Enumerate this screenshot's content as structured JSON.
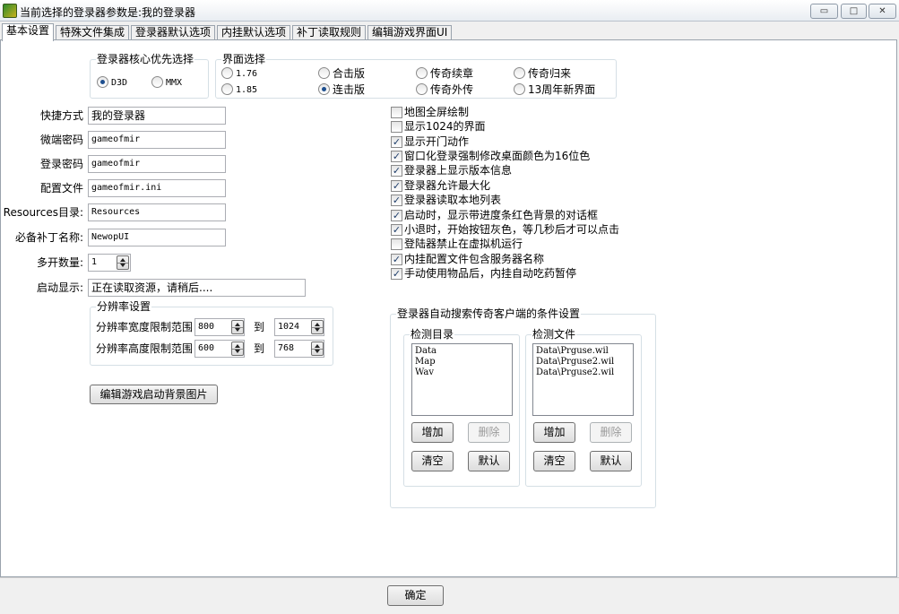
{
  "window": {
    "title": "当前选择的登录器参数是:我的登录器",
    "minimize_glyph": "▭",
    "restore_glyph": "□",
    "close_glyph": "✕"
  },
  "tabs": [
    "基本设置",
    "特殊文件集成",
    "登录器默认选项",
    "内挂默认选项",
    "补丁读取规则",
    "编辑游戏界面UI"
  ],
  "core": {
    "label": "登录器核心优先选择",
    "options": [
      {
        "label": "D3D",
        "selected": true
      },
      {
        "label": "MMX",
        "selected": false
      }
    ]
  },
  "ui_select": {
    "label": "界面选择",
    "options": [
      {
        "label": "1.76",
        "selected": false
      },
      {
        "label": "合击版",
        "selected": false
      },
      {
        "label": "传奇续章",
        "selected": false
      },
      {
        "label": "传奇归来",
        "selected": false
      },
      {
        "label": "1.85",
        "selected": false
      },
      {
        "label": "连击版",
        "selected": true
      },
      {
        "label": "传奇外传",
        "selected": false
      },
      {
        "label": "13周年新界面",
        "selected": false
      }
    ]
  },
  "form": {
    "shortcut": {
      "label": "快捷方式",
      "value": "我的登录器"
    },
    "micro_password": {
      "label": "微端密码",
      "value": "gameofmir"
    },
    "login_password": {
      "label": "登录密码",
      "value": "gameofmir"
    },
    "config_file": {
      "label": "配置文件",
      "value": "gameofmir.ini"
    },
    "resources_dir": {
      "label": "Resources目录:",
      "value": "Resources"
    },
    "patch_name": {
      "label": "必备补丁名称:",
      "value": "NewopUI"
    },
    "multi_count": {
      "label": "多开数量:",
      "value": "1"
    },
    "startup_text": {
      "label": "启动显示:",
      "value": "正在读取资源，请稍后...."
    }
  },
  "resolution": {
    "label": "分辨率设置",
    "width": {
      "label": "分辨率宽度限制范围",
      "min": "800",
      "to": "到",
      "max": "1024"
    },
    "height": {
      "label": "分辨率高度限制范围",
      "min": "600",
      "to": "到",
      "max": "768"
    }
  },
  "edit_bg_button": "编辑游戏启动背景图片",
  "checkboxes": [
    {
      "label": "地图全屏绘制",
      "checked": false
    },
    {
      "label": "显示1024的界面",
      "checked": false
    },
    {
      "label": "显示开门动作",
      "checked": true
    },
    {
      "label": "窗口化登录强制修改桌面颜色为16位色",
      "checked": true
    },
    {
      "label": "登录器上显示版本信息",
      "checked": true
    },
    {
      "label": "登录器允许最大化",
      "checked": true
    },
    {
      "label": "登录器读取本地列表",
      "checked": true
    },
    {
      "label": "启动时，显示带进度条红色背景的对话框",
      "checked": true
    },
    {
      "label": "小退时，开始按钮灰色，等几秒后才可以点击",
      "checked": true
    },
    {
      "label": "登陆器禁止在虚拟机运行",
      "checked": false
    },
    {
      "label": "内挂配置文件包含服务器名称",
      "checked": true
    },
    {
      "label": "手动使用物品后，内挂自动吃药暂停",
      "checked": true
    }
  ],
  "auto_search": {
    "label": "登录器自动搜索传奇客户端的条件设置",
    "dirs": {
      "label": "检测目录",
      "items": [
        "Data",
        "Map",
        "Wav"
      ],
      "add": "增加",
      "delete": "删除",
      "clear": "清空",
      "default": "默认"
    },
    "files": {
      "label": "检测文件",
      "items": [
        "Data\\Prguse.wil",
        "Data\\Prguse2.wil",
        "Data\\Prguse2.wil"
      ],
      "add": "增加",
      "delete": "删除",
      "clear": "清空",
      "default": "默认"
    }
  },
  "ok_button": "确定"
}
